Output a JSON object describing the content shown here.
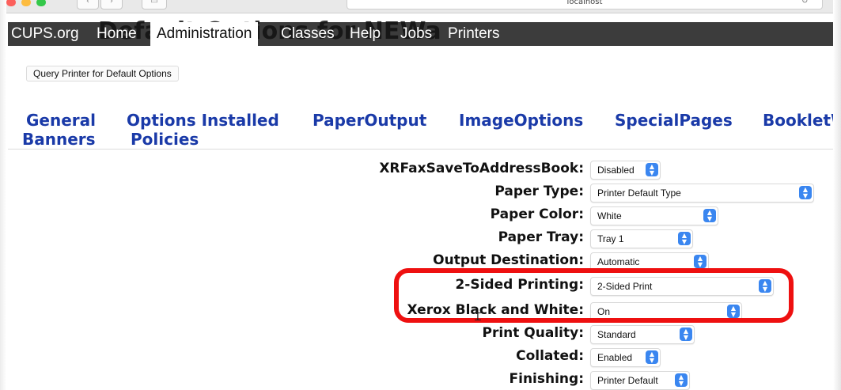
{
  "browser": {
    "url": "localhost",
    "back_icon": "chevron-left-icon",
    "forward_icon": "chevron-right-icon",
    "sidebar_icon": "sidebar-icon",
    "reload_icon": "reload-icon",
    "traffic_colors": [
      "#fc605c",
      "#fdbc40",
      "#34c84a"
    ]
  },
  "nav": {
    "background_text": "Default Options for NEWa",
    "items": [
      {
        "label": "CUPS.org"
      },
      {
        "label": "Home"
      },
      {
        "label": "Administration"
      },
      {
        "label": "Classes"
      },
      {
        "label": "Help"
      },
      {
        "label": "Jobs"
      },
      {
        "label": "Printers"
      }
    ]
  },
  "query_button": {
    "label": "Query Printer for Default Options"
  },
  "tabs": [
    {
      "label": "General"
    },
    {
      "label": "Banners"
    },
    {
      "label": "Options Installed"
    },
    {
      "label": "Policies"
    },
    {
      "label": "PaperOutput"
    },
    {
      "label": "ImageOptions"
    },
    {
      "label": "SpecialPages"
    },
    {
      "label": "BookletW"
    }
  ],
  "options": [
    {
      "label": "XRFaxSaveToAddressBook:",
      "value": "Disabled"
    },
    {
      "label": "Paper Type:",
      "value": "Printer Default Type"
    },
    {
      "label": "Paper Color:",
      "value": "White"
    },
    {
      "label": "Paper Tray:",
      "value": "Tray 1"
    },
    {
      "label": "Output Destination:",
      "value": "Automatic"
    },
    {
      "label": "2-Sided Printing:",
      "value": "2-Sided Print"
    },
    {
      "label": "Xerox Black and White:",
      "value": "On"
    },
    {
      "label": "Print Quality:",
      "value": "Standard"
    },
    {
      "label": "Collated:",
      "value": "Enabled"
    },
    {
      "label": "Finishing:",
      "value": "Printer Default"
    }
  ],
  "colors": {
    "tab_link": "#1a3aa8",
    "nav_bg": "#3c3c3c",
    "select_arrow": "#3a86f0",
    "highlight": "#ee1010"
  }
}
